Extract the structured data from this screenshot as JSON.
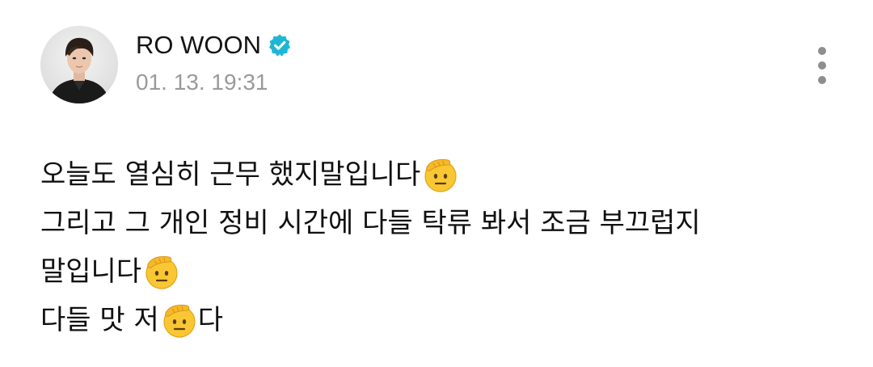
{
  "post": {
    "author_name": "RO WOON",
    "timestamp": "01. 13. 19:31",
    "verified": true,
    "body": {
      "line1_text": "오늘도 열심히 근무 했지말입니다",
      "line2_text": "그리고 그 개인 정비 시간에 다들 탁류 봐서 조금 부끄럽지",
      "line3_text": "말입니다",
      "line4_text_a": "다들 맛 저",
      "line4_text_b": "다",
      "emoji": "saluting-face"
    }
  },
  "colors": {
    "verified_badge": "#1fb6d6",
    "timestamp": "#9a9a9a",
    "text": "#111111",
    "more_dots": "#8e8e8e"
  }
}
